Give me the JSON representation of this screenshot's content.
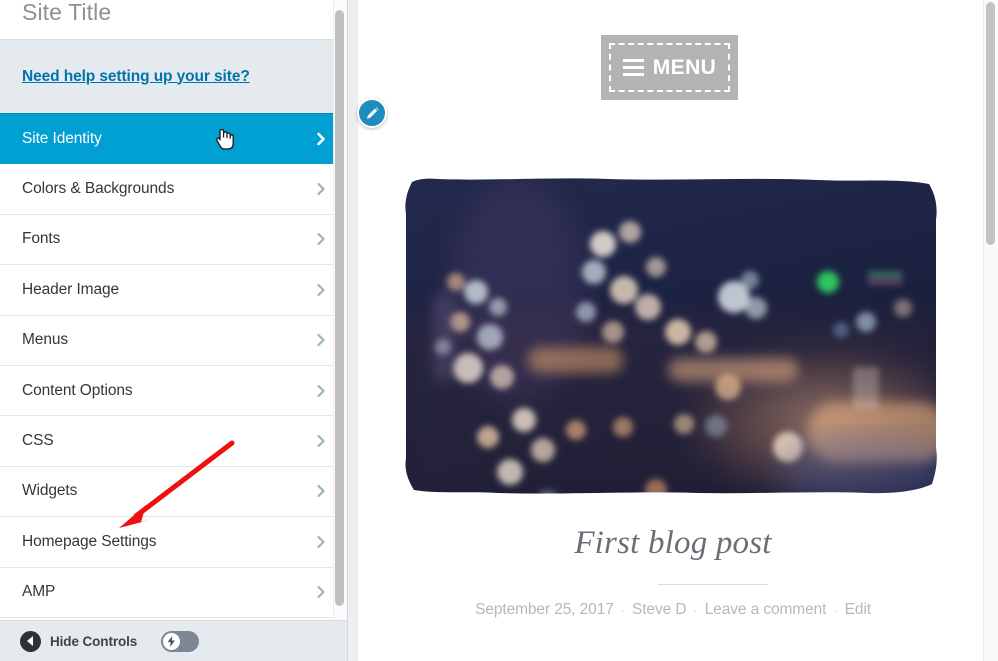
{
  "sidebar": {
    "site_title": "Site Title",
    "help_link": "Need help setting up your site?",
    "items": [
      {
        "label": "Site Identity",
        "active": true
      },
      {
        "label": "Colors & Backgrounds",
        "active": false
      },
      {
        "label": "Fonts",
        "active": false
      },
      {
        "label": "Header Image",
        "active": false
      },
      {
        "label": "Menus",
        "active": false
      },
      {
        "label": "Content Options",
        "active": false
      },
      {
        "label": "CSS",
        "active": false
      },
      {
        "label": "Widgets",
        "active": false
      },
      {
        "label": "Homepage Settings",
        "active": false
      },
      {
        "label": "AMP",
        "active": false
      }
    ],
    "footer": {
      "hide_controls_label": "Hide Controls",
      "toggle_state": "off"
    },
    "colors": {
      "active_row": "#00a0d2",
      "link": "#0073aa",
      "banner_bg": "#e5eaef",
      "text": "#32373c"
    }
  },
  "preview": {
    "menu_button_label": "MENU",
    "post": {
      "title": "First blog post",
      "date": "September 25, 2017",
      "author": "Steve D",
      "comments": "Leave a comment",
      "edit": "Edit",
      "separator": "·"
    }
  },
  "annotation": {
    "color": "#ee1111",
    "points_to": "Homepage Settings"
  }
}
